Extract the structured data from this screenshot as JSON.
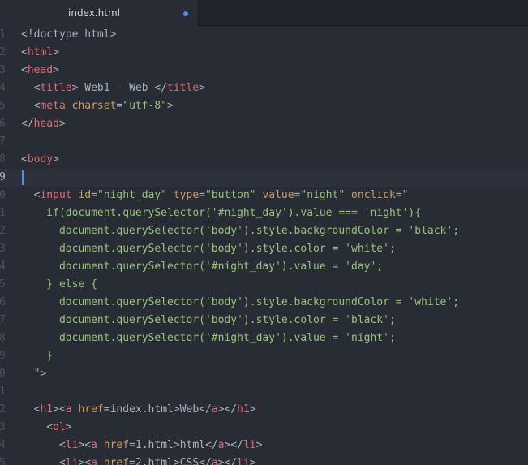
{
  "tab": {
    "title": "index.html",
    "modified": true
  },
  "colors": {
    "background": "#282c34",
    "tag": "#e06c75",
    "attribute": "#d19a66",
    "string": "#98c379",
    "text": "#abb2bf",
    "modified_dot": "#568af2"
  },
  "editor": {
    "cursor_line_index": 8,
    "lines": [
      {
        "num": "1",
        "tokens": [
          [
            "text",
            "<!doctype html>"
          ]
        ]
      },
      {
        "num": "2",
        "tokens": [
          [
            "text",
            "<"
          ],
          [
            "tag",
            "html"
          ],
          [
            "text",
            ">"
          ]
        ]
      },
      {
        "num": "3",
        "tokens": [
          [
            "text",
            "<"
          ],
          [
            "tag",
            "head"
          ],
          [
            "text",
            ">"
          ]
        ]
      },
      {
        "num": "4",
        "tokens": [
          [
            "text",
            "  <"
          ],
          [
            "tag",
            "title"
          ],
          [
            "text",
            "> Web1 - Web </"
          ],
          [
            "tag",
            "title"
          ],
          [
            "text",
            ">"
          ]
        ]
      },
      {
        "num": "5",
        "tokens": [
          [
            "text",
            "  <"
          ],
          [
            "tag",
            "meta"
          ],
          [
            "text",
            " "
          ],
          [
            "attr",
            "charset"
          ],
          [
            "text",
            "="
          ],
          [
            "str",
            "\"utf-8\""
          ],
          [
            "text",
            ">"
          ]
        ]
      },
      {
        "num": "6",
        "tokens": [
          [
            "text",
            "</"
          ],
          [
            "tag",
            "head"
          ],
          [
            "text",
            ">"
          ]
        ]
      },
      {
        "num": "7",
        "tokens": []
      },
      {
        "num": "8",
        "tokens": [
          [
            "text",
            "<"
          ],
          [
            "tag",
            "body"
          ],
          [
            "text",
            ">"
          ]
        ]
      },
      {
        "num": "9",
        "tokens": []
      },
      {
        "num": "0",
        "tokens": [
          [
            "text",
            "  <"
          ],
          [
            "tag",
            "input"
          ],
          [
            "text",
            " "
          ],
          [
            "attr",
            "id"
          ],
          [
            "text",
            "="
          ],
          [
            "str",
            "\"night_day\""
          ],
          [
            "text",
            " "
          ],
          [
            "attr",
            "type"
          ],
          [
            "text",
            "="
          ],
          [
            "str",
            "\"button\""
          ],
          [
            "text",
            " "
          ],
          [
            "attr",
            "value"
          ],
          [
            "text",
            "="
          ],
          [
            "str",
            "\"night\""
          ],
          [
            "text",
            " "
          ],
          [
            "attr",
            "onclick"
          ],
          [
            "text",
            "="
          ],
          [
            "str",
            "\""
          ]
        ]
      },
      {
        "num": "1",
        "tokens": [
          [
            "str",
            "    if(document.querySelector('#night_day').value === 'night'){"
          ]
        ]
      },
      {
        "num": "2",
        "tokens": [
          [
            "str",
            "      document.querySelector('body').style.backgroundColor = 'black';"
          ]
        ]
      },
      {
        "num": "3",
        "tokens": [
          [
            "str",
            "      document.querySelector('body').style.color = 'white';"
          ]
        ]
      },
      {
        "num": "4",
        "tokens": [
          [
            "str",
            "      document.querySelector('#night_day').value = 'day';"
          ]
        ]
      },
      {
        "num": "5",
        "tokens": [
          [
            "str",
            "    } else {"
          ]
        ]
      },
      {
        "num": "6",
        "tokens": [
          [
            "str",
            "      document.querySelector('body').style.backgroundColor = 'white';"
          ]
        ]
      },
      {
        "num": "7",
        "tokens": [
          [
            "str",
            "      document.querySelector('body').style.color = 'black';"
          ]
        ]
      },
      {
        "num": "8",
        "tokens": [
          [
            "str",
            "      document.querySelector('#night_day').value = 'night';"
          ]
        ]
      },
      {
        "num": "9",
        "tokens": [
          [
            "str",
            "    }"
          ]
        ]
      },
      {
        "num": "0",
        "tokens": [
          [
            "str",
            "  \""
          ],
          [
            "text",
            ">"
          ]
        ]
      },
      {
        "num": "1",
        "tokens": []
      },
      {
        "num": "2",
        "tokens": [
          [
            "text",
            "  <"
          ],
          [
            "tag",
            "h1"
          ],
          [
            "text",
            "><"
          ],
          [
            "tag",
            "a"
          ],
          [
            "text",
            " "
          ],
          [
            "attr",
            "href"
          ],
          [
            "text",
            "=index.html>Web</"
          ],
          [
            "tag",
            "a"
          ],
          [
            "text",
            "></"
          ],
          [
            "tag",
            "h1"
          ],
          [
            "text",
            ">"
          ]
        ]
      },
      {
        "num": "3",
        "tokens": [
          [
            "text",
            "    <"
          ],
          [
            "tag",
            "ol"
          ],
          [
            "text",
            ">"
          ]
        ]
      },
      {
        "num": "4",
        "tokens": [
          [
            "text",
            "      <"
          ],
          [
            "tag",
            "li"
          ],
          [
            "text",
            "><"
          ],
          [
            "tag",
            "a"
          ],
          [
            "text",
            " "
          ],
          [
            "attr",
            "href"
          ],
          [
            "text",
            "=1.html>html</"
          ],
          [
            "tag",
            "a"
          ],
          [
            "text",
            "></"
          ],
          [
            "tag",
            "li"
          ],
          [
            "text",
            ">"
          ]
        ]
      },
      {
        "num": "5",
        "tokens": [
          [
            "text",
            "      <"
          ],
          [
            "tag",
            "li"
          ],
          [
            "text",
            "><"
          ],
          [
            "tag",
            "a"
          ],
          [
            "text",
            " "
          ],
          [
            "attr",
            "href"
          ],
          [
            "text",
            "=2.html>CSS</"
          ],
          [
            "tag",
            "a"
          ],
          [
            "text",
            "></"
          ],
          [
            "tag",
            "li"
          ],
          [
            "text",
            ">"
          ]
        ]
      }
    ]
  }
}
